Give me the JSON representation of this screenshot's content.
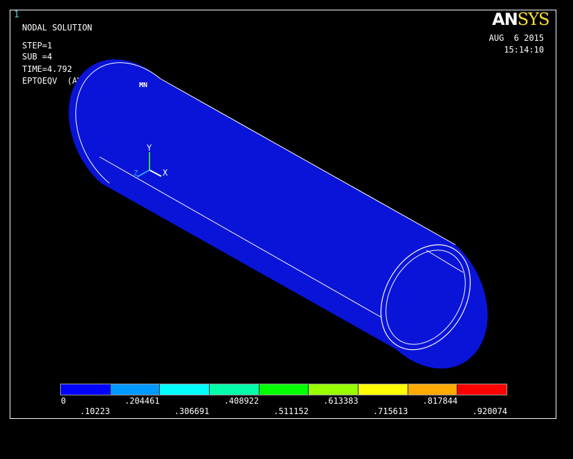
{
  "window_number": "1",
  "header": {
    "plot_title": "NODAL SOLUTION",
    "step": "STEP=1",
    "sub": "SUB =4",
    "time": "TIME=4.792",
    "result": "EPTOEQV  (AVG)"
  },
  "timestamp": {
    "date": "AUG  6 2015",
    "time": "15:14:10"
  },
  "logo": {
    "left": "AN",
    "right": "SYS"
  },
  "model": {
    "min_marker": "MN",
    "fill_color": "#0a14d8",
    "edge_color": "#ffffff"
  },
  "triad": {
    "x_label": "X",
    "y_label": "Y",
    "z_label": "Z",
    "x_color": "#ffffff",
    "y_color": "#33dd33",
    "z_color": "#3399ff"
  },
  "legend": {
    "colors": [
      "#0000ff",
      "#0099ff",
      "#00ffff",
      "#00ffaa",
      "#00ff00",
      "#99ff00",
      "#ffff00",
      "#ffaa00",
      "#ff0000"
    ],
    "top_labels": [
      "0",
      ".204461",
      ".408922",
      ".613383",
      ".817844"
    ],
    "bottom_labels": [
      ".10223",
      ".306691",
      ".511152",
      ".715613",
      ".920074"
    ]
  }
}
